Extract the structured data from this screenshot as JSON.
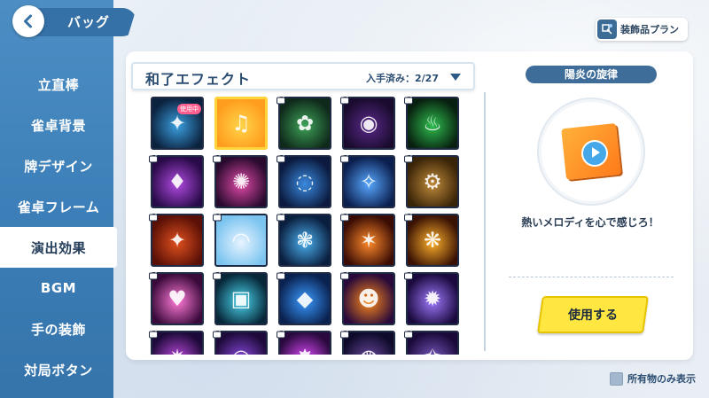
{
  "header": {
    "title": "バッグ"
  },
  "plan_button": {
    "label": "装飾品プラン",
    "icon": "plan-icon"
  },
  "sidebar": {
    "items": [
      {
        "label": "立直棒",
        "active": false
      },
      {
        "label": "雀卓背景",
        "active": false
      },
      {
        "label": "牌デザイン",
        "active": false
      },
      {
        "label": "雀卓フレーム",
        "active": false
      },
      {
        "label": "演出効果",
        "active": true
      },
      {
        "label": "BGM",
        "active": false
      },
      {
        "label": "手の装飾",
        "active": false
      },
      {
        "label": "対局ボタン",
        "active": false
      }
    ]
  },
  "list": {
    "title": "和了エフェクト",
    "count": "入手済み：2/27",
    "in_use_badge": "使用中",
    "tiles": [
      {
        "icon": "lightning-burst-icon",
        "locked": false,
        "in_use": true,
        "selected": false,
        "colors": [
          "#0c2340",
          "#3aa0e0"
        ]
      },
      {
        "icon": "music-note-icon",
        "locked": false,
        "in_use": false,
        "selected": true,
        "colors": [
          "#ff9d1e",
          "#ffd54a"
        ]
      },
      {
        "icon": "green-spirit-icon",
        "locked": true,
        "in_use": false,
        "selected": false,
        "colors": [
          "#0f2a1a",
          "#3fa35a"
        ]
      },
      {
        "icon": "dark-orbs-icon",
        "locked": true,
        "in_use": false,
        "selected": false,
        "colors": [
          "#1a0b2e",
          "#5a2a8a"
        ]
      },
      {
        "icon": "green-flame-icon",
        "locked": true,
        "in_use": false,
        "selected": false,
        "colors": [
          "#08200f",
          "#2ebd4f"
        ]
      },
      {
        "icon": "purple-crystal-icon",
        "locked": true,
        "in_use": false,
        "selected": false,
        "colors": [
          "#2a0b4a",
          "#b04ae0"
        ]
      },
      {
        "icon": "pink-bloom-icon",
        "locked": true,
        "in_use": false,
        "selected": false,
        "colors": [
          "#2a0b2e",
          "#e04aa8"
        ]
      },
      {
        "icon": "blue-swirl-icon",
        "locked": true,
        "in_use": false,
        "selected": false,
        "colors": [
          "#0b1a3e",
          "#3a8ae0"
        ]
      },
      {
        "icon": "blue-shard-icon",
        "locked": true,
        "in_use": false,
        "selected": false,
        "colors": [
          "#0c2050",
          "#58a8ff"
        ]
      },
      {
        "icon": "gear-icon",
        "locked": true,
        "in_use": false,
        "selected": false,
        "colors": [
          "#3a2408",
          "#c08a3a"
        ]
      },
      {
        "icon": "kanji-banner-icon",
        "locked": true,
        "in_use": false,
        "selected": false,
        "colors": [
          "#5a1006",
          "#e0501e"
        ]
      },
      {
        "icon": "rainbow-icon",
        "locked": true,
        "in_use": false,
        "selected": false,
        "colors": [
          "#7bc4f0",
          "#e8f4ff"
        ]
      },
      {
        "icon": "water-splash-icon",
        "locked": true,
        "in_use": false,
        "selected": false,
        "colors": [
          "#0a1e3e",
          "#4ab0f0"
        ]
      },
      {
        "icon": "fire-blade-icon",
        "locked": true,
        "in_use": false,
        "selected": false,
        "colors": [
          "#3a0c04",
          "#ff8a2a"
        ]
      },
      {
        "icon": "fire-phoenix-icon",
        "locked": true,
        "in_use": false,
        "selected": false,
        "colors": [
          "#3a1204",
          "#ffb02a"
        ]
      },
      {
        "icon": "heart-icon",
        "locked": true,
        "in_use": false,
        "selected": false,
        "colors": [
          "#3a0a3a",
          "#ff7ad8"
        ]
      },
      {
        "icon": "cyan-cube-icon",
        "locked": true,
        "in_use": false,
        "selected": false,
        "colors": [
          "#08283a",
          "#4ad8f0"
        ]
      },
      {
        "icon": "blue-box-icon",
        "locked": true,
        "in_use": false,
        "selected": false,
        "colors": [
          "#0a2250",
          "#3a9aff"
        ]
      },
      {
        "icon": "pumpkin-icon",
        "locked": true,
        "in_use": false,
        "selected": false,
        "colors": [
          "#2a0a3a",
          "#ff8a1a"
        ]
      },
      {
        "icon": "purple-orb-icon",
        "locked": true,
        "in_use": false,
        "selected": false,
        "colors": [
          "#1a0a3e",
          "#a07aff"
        ]
      },
      {
        "icon": "purple-ray-icon",
        "locked": true,
        "in_use": false,
        "selected": false,
        "colors": [
          "#1e0a3a",
          "#c04ae0"
        ]
      },
      {
        "icon": "violet-ring-icon",
        "locked": true,
        "in_use": false,
        "selected": false,
        "colors": [
          "#1e0a3a",
          "#8a4ae0"
        ]
      },
      {
        "icon": "magenta-flare-icon",
        "locked": true,
        "in_use": false,
        "selected": false,
        "colors": [
          "#2a0a3e",
          "#e04aff"
        ]
      },
      {
        "icon": "dark-vortex-icon",
        "locked": true,
        "in_use": false,
        "selected": false,
        "colors": [
          "#0e0a2a",
          "#6a4aa0"
        ]
      },
      {
        "icon": "night-spark-icon",
        "locked": true,
        "in_use": false,
        "selected": false,
        "colors": [
          "#1a0a3a",
          "#7a5ac0"
        ]
      }
    ]
  },
  "detail": {
    "title": "陽炎の旋律",
    "description": "熱いメロディを心で感じろ！",
    "use_button": "使用する",
    "preview_icon": "music-play-icon"
  },
  "filter": {
    "owned_only_label": "所有物のみ表示",
    "checked": false
  },
  "colors": {
    "sidebar": "#3d7fb8",
    "accent_yellow": "#ffe640",
    "title_navy": "#2b4d72"
  }
}
